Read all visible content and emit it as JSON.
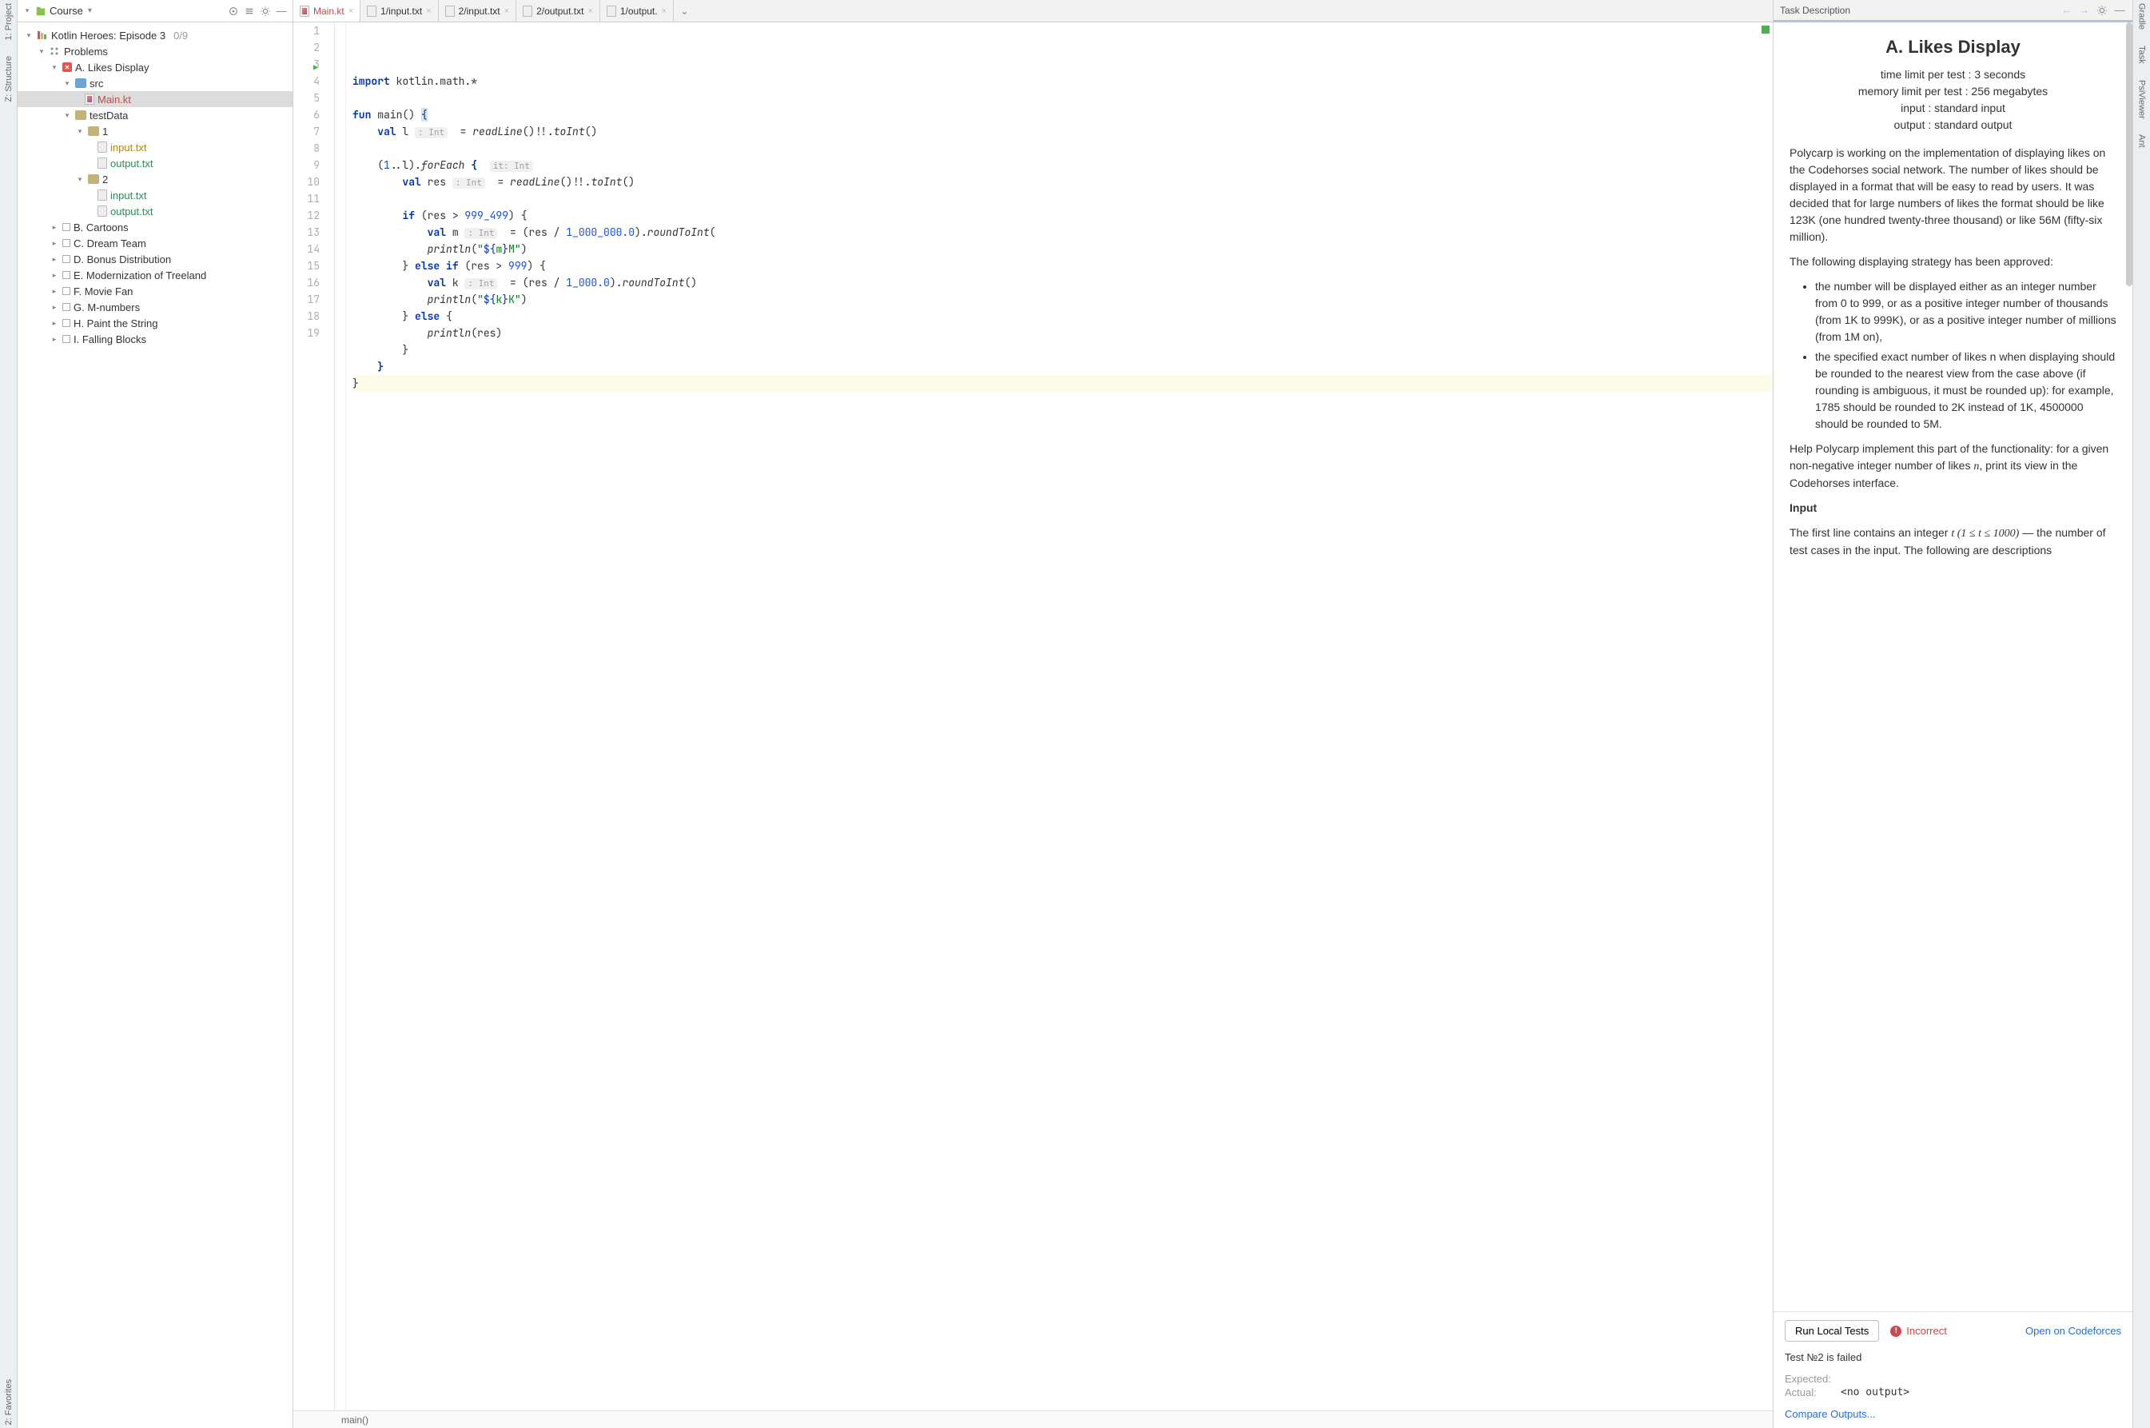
{
  "left_stripe": {
    "items": [
      "1: Project",
      "Z: Structure"
    ],
    "bottom": [
      "2: Favorites"
    ]
  },
  "right_stripe": {
    "items": [
      "Gradle",
      "Task",
      "PsiViewer",
      "Ant"
    ]
  },
  "project": {
    "toolbar_label": "Course",
    "root": {
      "label": "Kotlin Heroes: Episode 3",
      "progress": "0/9"
    },
    "problems_label": "Problems",
    "items": [
      {
        "label": "A. Likes Display",
        "status": "fail",
        "children": [
          {
            "label": "src",
            "type": "folder-blue",
            "children": [
              {
                "label": "Main.kt",
                "type": "kt",
                "color": "red",
                "selected": true
              }
            ]
          },
          {
            "label": "testData",
            "type": "folder",
            "children": [
              {
                "label": "1",
                "type": "folder",
                "children": [
                  {
                    "label": "input.txt",
                    "type": "file",
                    "color": "orange"
                  },
                  {
                    "label": "output.txt",
                    "type": "file",
                    "color": "green"
                  }
                ]
              },
              {
                "label": "2",
                "type": "folder",
                "children": [
                  {
                    "label": "input.txt",
                    "type": "file",
                    "color": "green"
                  },
                  {
                    "label": "output.txt",
                    "type": "file",
                    "color": "green"
                  }
                ]
              }
            ]
          }
        ]
      },
      {
        "label": "B. Cartoons"
      },
      {
        "label": "C. Dream Team"
      },
      {
        "label": "D. Bonus Distribution"
      },
      {
        "label": "E. Modernization of Treeland"
      },
      {
        "label": "F. Movie Fan"
      },
      {
        "label": "G. M-numbers"
      },
      {
        "label": "H. Paint the String"
      },
      {
        "label": "I. Falling Blocks"
      }
    ]
  },
  "editor": {
    "tabs": [
      {
        "label": "Main.kt",
        "icon": "kt",
        "active": true,
        "color": "red"
      },
      {
        "label": "1/input.txt",
        "icon": "file"
      },
      {
        "label": "2/input.txt",
        "icon": "file"
      },
      {
        "label": "2/output.txt",
        "icon": "file"
      },
      {
        "label": "1/output.",
        "icon": "file"
      }
    ],
    "breadcrumb": "main()",
    "line_count": 19,
    "run_marker_line": 3,
    "code_lines": [
      {
        "html": "<span class='kw'>import</span> kotlin.math.*"
      },
      {
        "html": ""
      },
      {
        "html": "<span class='kw'>fun</span> main() <span style='background:#cde3ff'>{</span>"
      },
      {
        "html": "    <span class='kw'>val</span> l <span class='hint'>: Int</span>  = <span class='fn'>readLine</span>()!!.<span class='fn'>toInt</span>()"
      },
      {
        "html": ""
      },
      {
        "html": "    (<span class='num'>1</span>..l).<span class='fn'>forEach</span> <span class='kw'>{</span>  <span class='hint'>it: Int</span>"
      },
      {
        "html": "        <span class='kw'>val</span> res <span class='hint'>: Int</span>  = <span class='fn'>readLine</span>()!!.<span class='fn'>toInt</span>()"
      },
      {
        "html": ""
      },
      {
        "html": "        <span class='kw'>if</span> (res &gt; <span class='num'>999_499</span>) {"
      },
      {
        "html": "            <span class='kw'>val</span> m <span class='hint'>: Int</span>  = (res / <span class='num'>1_000_000.0</span>).<span class='fn'>roundToInt</span>("
      },
      {
        "html": "            <span class='fn'>println</span>(<span class='str'>\"<span class='inj'>${</span>m<span class='inj'>}</span>M\"</span>)"
      },
      {
        "html": "        } <span class='kw'>else if</span> (res &gt; <span class='num'>999</span>) {"
      },
      {
        "html": "            <span class='kw'>val</span> k <span class='hint'>: Int</span>  = (res / <span class='num'>1_000.0</span>).<span class='fn'>roundToInt</span>()"
      },
      {
        "html": "            <span class='fn'>println</span>(<span class='str'>\"<span class='inj'>${</span>k<span class='inj'>}</span>K\"</span>)"
      },
      {
        "html": "        } <span class='kw'>else</span> {"
      },
      {
        "html": "            <span class='fn'>println</span>(res)"
      },
      {
        "html": "        }"
      },
      {
        "html": "    <span class='kw'>}</span>"
      },
      {
        "html": "}",
        "hl": true
      }
    ]
  },
  "task": {
    "panel_title": "Task Description",
    "title": "A. Likes Display",
    "meta": {
      "time": "time limit per test : 3 seconds",
      "memory": "memory limit per test : 256 megabytes",
      "input": "input : standard input",
      "output": "output : standard output"
    },
    "para1": "Polycarp is working on the implementation of displaying likes on the Codehorses social network. The number of likes should be displayed in a format that will be easy to read by users. It was decided that for large numbers of likes the format should be like 123K (one hundred twenty-three thousand) or like 56M (fifty-six million).",
    "para2": "The following displaying strategy has been approved:",
    "bullets": [
      "the number will be displayed either as an integer number from 0 to 999, or as a positive integer number of thousands (from 1K to 999K), or as a positive integer number of millions (from 1M on),",
      "the specified exact number of likes n when displaying should be rounded to the nearest view from the case above (if rounding is ambiguous, it must be rounded up): for example, 1785 should be rounded to 2K instead of 1K, 4500000 should be rounded to 5M."
    ],
    "para3_a": "Help Polycarp implement this part of the functionality: for a given non-negative integer number of likes ",
    "para3_b": ", print its view in the Codehorses interface.",
    "input_heading": "Input",
    "input_text_a": "The first line contains an integer ",
    "input_text_b": " — the number of test cases in the input. The following are descriptions",
    "input_math": "t (1 ≤ t ≤ 1000)",
    "footer": {
      "run_label": "Run Local Tests",
      "status": "Incorrect",
      "open_link": "Open on Codeforces",
      "fail_line": "Test №2 is failed",
      "expected_k": "Expected:",
      "expected_v": "",
      "actual_k": "Actual:",
      "actual_v": "<no output>",
      "compare": "Compare Outputs..."
    }
  }
}
